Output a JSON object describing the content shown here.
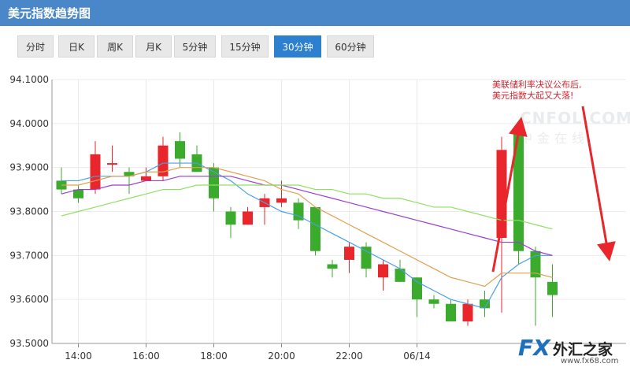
{
  "header": {
    "title": "美元指数趋势图"
  },
  "tabs": [
    {
      "label": "分时",
      "active": false
    },
    {
      "label": "日K",
      "active": false
    },
    {
      "label": "周K",
      "active": false
    },
    {
      "label": "月K",
      "active": false
    },
    {
      "label": "5分钟",
      "active": false
    },
    {
      "label": "15分钟",
      "active": false
    },
    {
      "label": "30分钟",
      "active": true
    },
    {
      "label": "60分钟",
      "active": false
    }
  ],
  "annotation": {
    "line1": "美联储利率决议公布后,",
    "line2": "美元指数大起又大落!"
  },
  "watermark": {
    "brand": "CNFOL.COM",
    "cn": "中金在线"
  },
  "logo": {
    "fx": "FX",
    "name": "外汇之家",
    "url": "www.fx68.com"
  },
  "colors": {
    "up": "#e8262b",
    "down": "#3bab2e",
    "ma5": "#4aa0e0",
    "ma10": "#e0a050",
    "ma20": "#9a3fd0",
    "ma30": "#8fe060",
    "arrow": "#e8262b",
    "grid": "#ebebeb"
  },
  "chart_data": {
    "type": "candlestick",
    "ylim": [
      93.5,
      94.1
    ],
    "yticks": [
      "93.5000",
      "93.6000",
      "93.7000",
      "93.8000",
      "93.9000",
      "94.0000",
      "94.1000"
    ],
    "xticks": [
      {
        "label": "14:00",
        "index": 1
      },
      {
        "label": "16:00",
        "index": 5
      },
      {
        "label": "18:00",
        "index": 9
      },
      {
        "label": "20:00",
        "index": 13
      },
      {
        "label": "22:00",
        "index": 17
      },
      {
        "label": "06/14",
        "index": 21
      }
    ],
    "candles": [
      {
        "o": 93.87,
        "h": 93.9,
        "l": 93.84,
        "c": 93.85
      },
      {
        "o": 93.85,
        "h": 93.86,
        "l": 93.82,
        "c": 93.83
      },
      {
        "o": 93.85,
        "h": 93.96,
        "l": 93.84,
        "c": 93.93
      },
      {
        "o": 93.91,
        "h": 93.95,
        "l": 93.89,
        "c": 93.91
      },
      {
        "o": 93.89,
        "h": 93.9,
        "l": 93.84,
        "c": 93.88
      },
      {
        "o": 93.87,
        "h": 93.9,
        "l": 93.87,
        "c": 93.88
      },
      {
        "o": 93.88,
        "h": 93.97,
        "l": 93.87,
        "c": 93.95
      },
      {
        "o": 93.96,
        "h": 93.98,
        "l": 93.9,
        "c": 93.92
      },
      {
        "o": 93.93,
        "h": 93.95,
        "l": 93.89,
        "c": 93.89
      },
      {
        "o": 93.9,
        "h": 93.91,
        "l": 93.8,
        "c": 93.83
      },
      {
        "o": 93.8,
        "h": 93.81,
        "l": 93.74,
        "c": 93.77
      },
      {
        "o": 93.77,
        "h": 93.81,
        "l": 93.77,
        "c": 93.8
      },
      {
        "o": 93.81,
        "h": 93.84,
        "l": 93.77,
        "c": 93.83
      },
      {
        "o": 93.82,
        "h": 93.87,
        "l": 93.81,
        "c": 93.83
      },
      {
        "o": 93.82,
        "h": 93.83,
        "l": 93.76,
        "c": 93.78
      },
      {
        "o": 93.81,
        "h": 93.81,
        "l": 93.7,
        "c": 93.71
      },
      {
        "o": 93.68,
        "h": 93.69,
        "l": 93.65,
        "c": 93.67
      },
      {
        "o": 93.69,
        "h": 93.73,
        "l": 93.66,
        "c": 93.72
      },
      {
        "o": 93.72,
        "h": 93.73,
        "l": 93.65,
        "c": 93.67
      },
      {
        "o": 93.65,
        "h": 93.69,
        "l": 93.62,
        "c": 93.68
      },
      {
        "o": 93.67,
        "h": 93.69,
        "l": 93.64,
        "c": 93.64
      },
      {
        "o": 93.65,
        "h": 93.65,
        "l": 93.56,
        "c": 93.6
      },
      {
        "o": 93.6,
        "h": 93.61,
        "l": 93.58,
        "c": 93.59
      },
      {
        "o": 93.59,
        "h": 93.6,
        "l": 93.55,
        "c": 93.55
      },
      {
        "o": 93.55,
        "h": 93.6,
        "l": 93.54,
        "c": 93.59
      },
      {
        "o": 93.6,
        "h": 93.62,
        "l": 93.56,
        "c": 93.58
      },
      {
        "o": 93.74,
        "h": 93.97,
        "l": 93.57,
        "c": 93.94
      },
      {
        "o": 93.99,
        "h": 94.0,
        "l": 93.68,
        "c": 93.71
      },
      {
        "o": 93.71,
        "h": 93.72,
        "l": 93.54,
        "c": 93.65
      },
      {
        "o": 93.64,
        "h": 93.68,
        "l": 93.56,
        "c": 93.61
      }
    ],
    "ma": [
      {
        "name": "MA5",
        "values": [
          93.87,
          93.87,
          93.88,
          93.88,
          93.88,
          93.89,
          93.91,
          93.91,
          93.91,
          93.89,
          93.87,
          93.84,
          93.82,
          93.8,
          93.79,
          93.77,
          93.75,
          93.73,
          93.71,
          93.69,
          93.67,
          93.64,
          93.62,
          93.6,
          93.59,
          93.58,
          93.65,
          93.68,
          93.7,
          93.7
        ]
      },
      {
        "name": "MA10",
        "values": [
          93.86,
          93.86,
          93.87,
          93.88,
          93.88,
          93.89,
          93.89,
          93.9,
          93.9,
          93.9,
          93.89,
          93.88,
          93.87,
          93.85,
          93.84,
          93.81,
          93.79,
          93.77,
          93.75,
          93.73,
          93.71,
          93.69,
          93.67,
          93.65,
          93.64,
          93.63,
          93.66,
          93.66,
          93.66,
          93.65
        ]
      },
      {
        "name": "MA20",
        "values": [
          93.84,
          93.85,
          93.85,
          93.86,
          93.86,
          93.87,
          93.87,
          93.88,
          93.88,
          93.88,
          93.88,
          93.87,
          93.86,
          93.86,
          93.85,
          93.84,
          93.83,
          93.82,
          93.81,
          93.8,
          93.79,
          93.78,
          93.77,
          93.76,
          93.75,
          93.74,
          93.73,
          93.73,
          93.71,
          93.7
        ]
      },
      {
        "name": "MA30",
        "values": [
          93.79,
          93.8,
          93.81,
          93.82,
          93.83,
          93.84,
          93.85,
          93.85,
          93.86,
          93.86,
          93.86,
          93.86,
          93.86,
          93.86,
          93.86,
          93.85,
          93.85,
          93.84,
          93.84,
          93.83,
          93.83,
          93.82,
          93.81,
          93.81,
          93.8,
          93.79,
          93.78,
          93.78,
          93.77,
          93.76
        ]
      }
    ]
  }
}
